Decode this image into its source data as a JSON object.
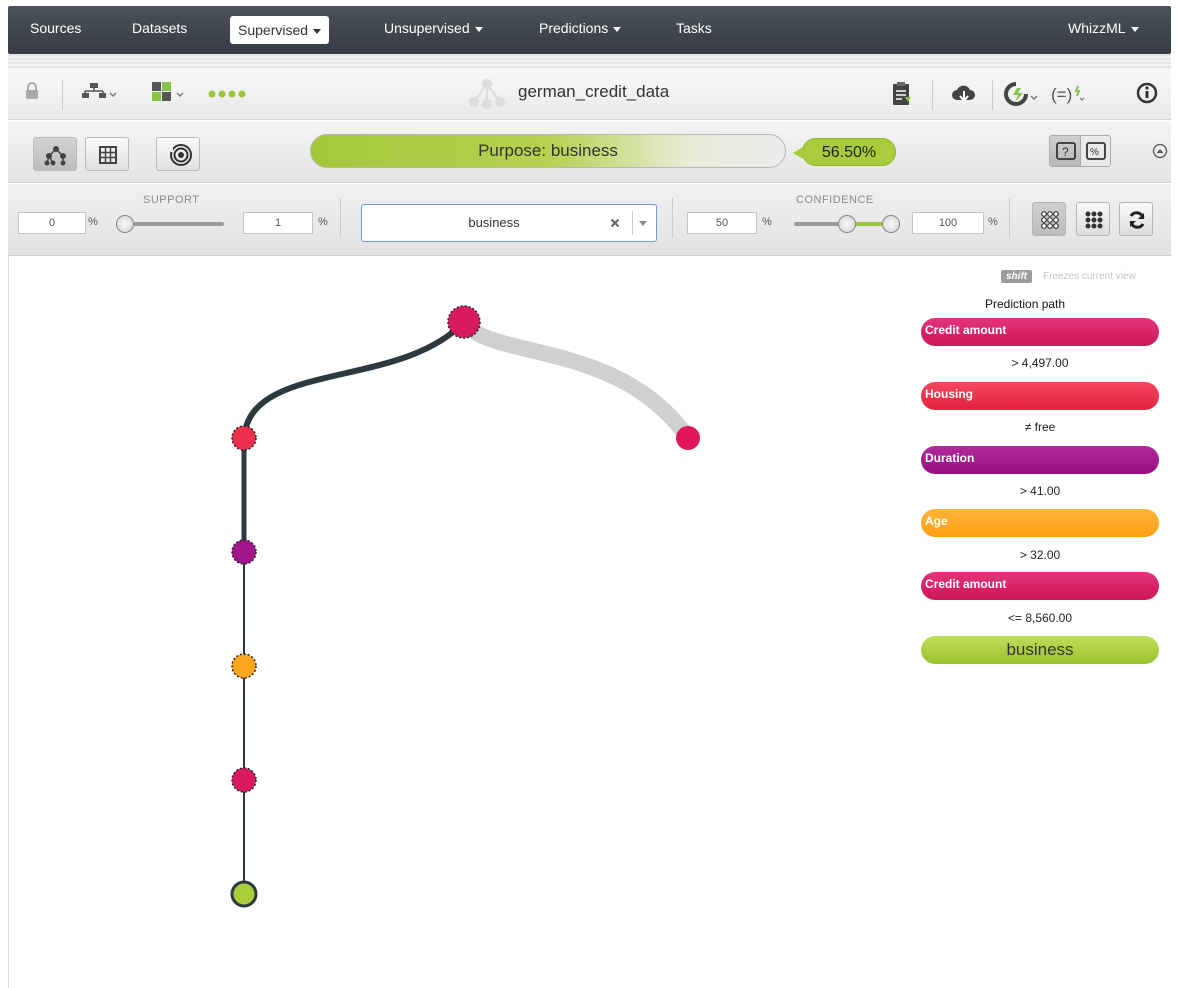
{
  "nav": {
    "sources": "Sources",
    "datasets": "Datasets",
    "supervised": "Supervised",
    "unsupervised": "Unsupervised",
    "predictions": "Predictions",
    "tasks": "Tasks",
    "whizzml": "WhizzML"
  },
  "title": "german_credit_data",
  "view": {
    "purpose_label": "Purpose: business",
    "confidence_badge": "56.50%"
  },
  "filters": {
    "support_label": "SUPPORT",
    "support_min": "0",
    "support_max": "1",
    "confidence_label": "CONFIDENCE",
    "confidence_min": "50",
    "confidence_max": "100",
    "percent": "%",
    "objective_value": "business"
  },
  "panel": {
    "shift_key": "shift",
    "freeze_hint": "Freezes current view",
    "title": "Prediction path",
    "path": [
      {
        "field": "Credit amount",
        "condition": "> 4,497.00",
        "color": "#d81b60"
      },
      {
        "field": "Housing",
        "condition": "≠ free",
        "color": "#ec2f4b"
      },
      {
        "field": "Duration",
        "condition": "> 41.00",
        "color": "#a1168a"
      },
      {
        "field": "Age",
        "condition": "> 32.00",
        "color": "#ffa51e"
      },
      {
        "field": "Credit amount",
        "condition": "<= 8,560.00",
        "color": "#d81b60"
      }
    ],
    "prediction": "business"
  },
  "colors": {
    "nav_bg": "#3d4348",
    "path_line": "#2c3a40",
    "branch_gray": "#d0d0d0",
    "prediction_green": "#aacd3c"
  }
}
